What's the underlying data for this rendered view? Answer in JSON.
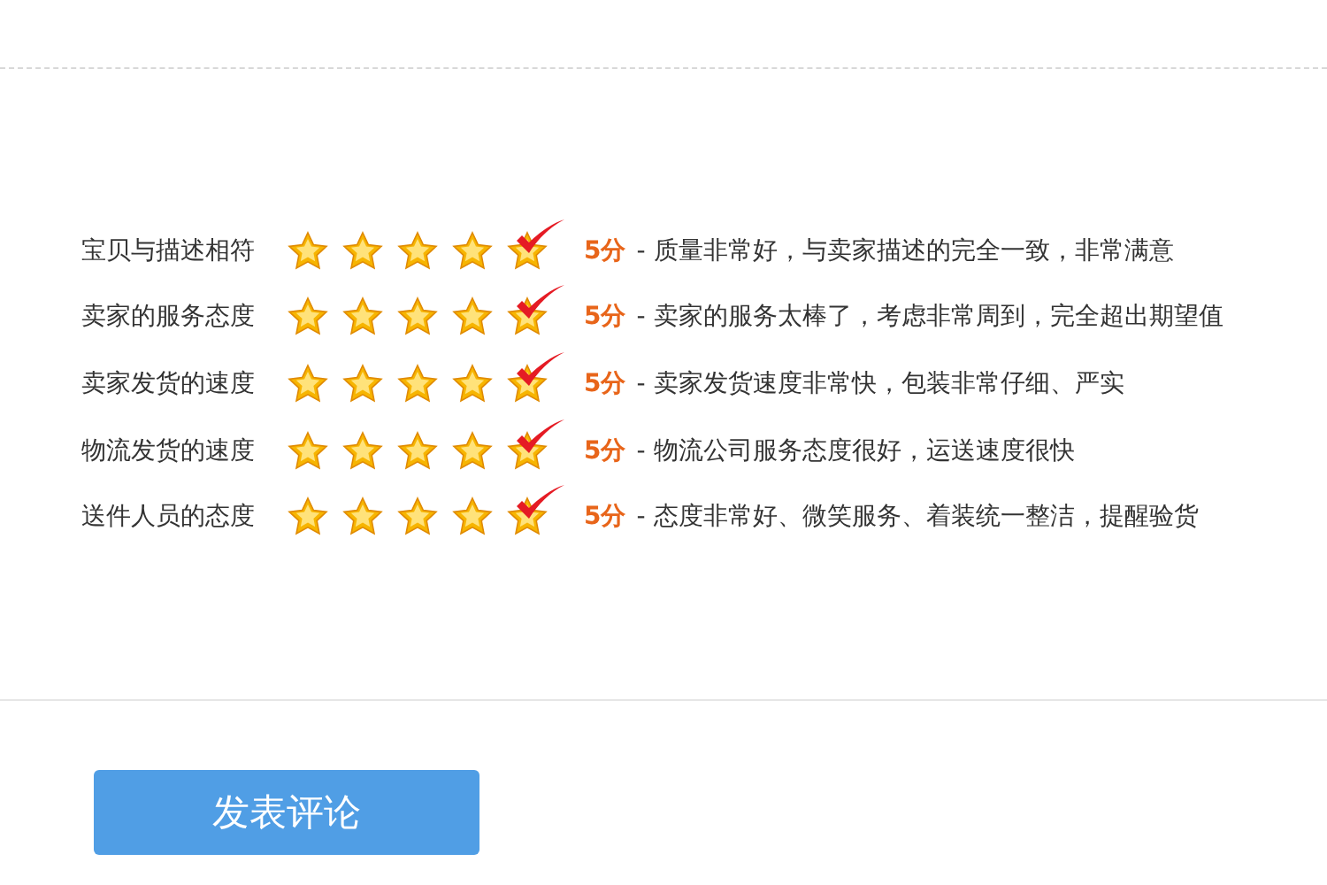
{
  "ratings": [
    {
      "label": "宝贝与描述相符",
      "stars": 5,
      "score": "5分",
      "comment": "- 质量非常好，与卖家描述的完全一致，非常满意"
    },
    {
      "label": "卖家的服务态度",
      "stars": 5,
      "score": "5分",
      "comment": "- 卖家的服务太棒了，考虑非常周到，完全超出期望值"
    },
    {
      "label": "卖家发货的速度",
      "stars": 5,
      "score": "5分",
      "comment": "- 卖家发货速度非常快，包装非常仔细、严实"
    },
    {
      "label": "物流发货的速度",
      "stars": 5,
      "score": "5分",
      "comment": "- 物流公司服务态度很好，运送速度很快"
    },
    {
      "label": "送件人员的态度",
      "stars": 5,
      "score": "5分",
      "comment": "- 态度非常好、微笑服务、着装统一整洁，提醒验货"
    }
  ],
  "submit_button": "发表评论"
}
